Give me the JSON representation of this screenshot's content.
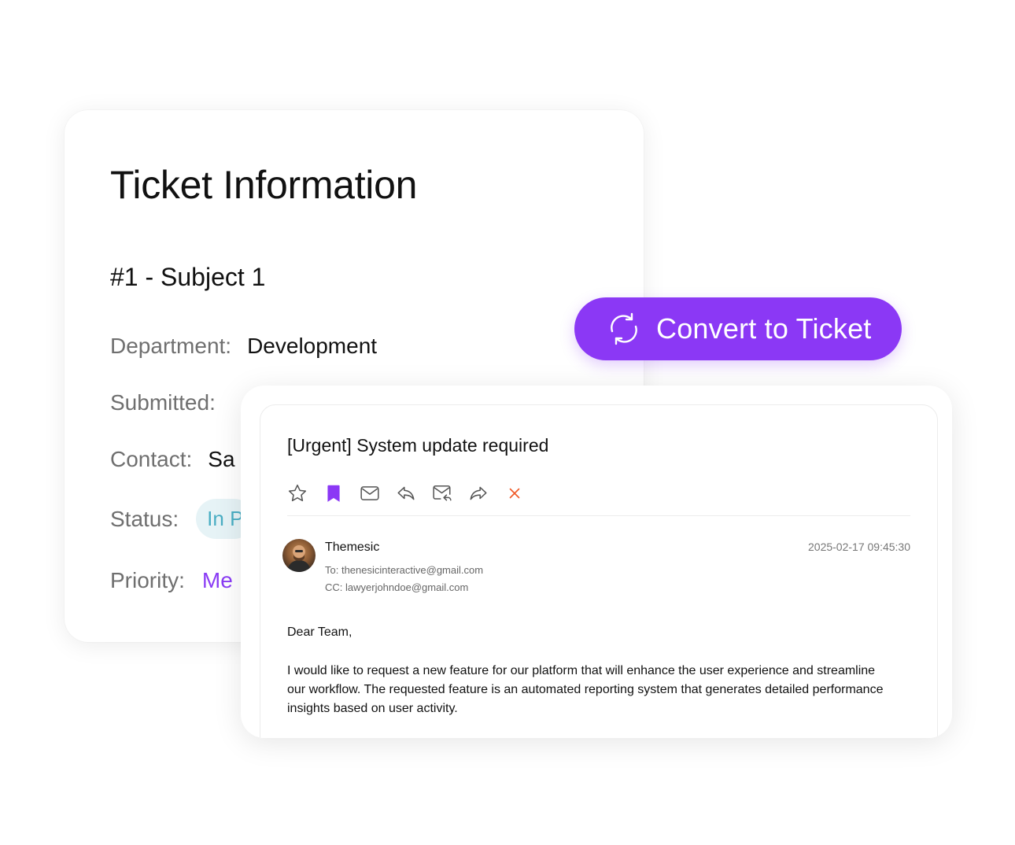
{
  "ticket": {
    "title": "Ticket Information",
    "subject": "#1 - Subject 1",
    "department_label": "Department:",
    "department_value": "Development",
    "submitted_label": "Submitted:",
    "contact_label": "Contact:",
    "contact_value": "Sa",
    "status_label": "Status:",
    "status_value": "In P",
    "priority_label": "Priority:",
    "priority_value": "Me"
  },
  "convert_button": {
    "label": "Convert to Ticket",
    "icon": "refresh-icon"
  },
  "email": {
    "subject": "[Urgent] System update required",
    "toolbar_icons": [
      "star-icon",
      "bookmark-icon",
      "mail-icon",
      "reply-icon",
      "reply-all-icon",
      "forward-icon",
      "close-icon"
    ],
    "sender": "Themesic",
    "date": "2025-02-17 09:45:30",
    "to": "To: thenesicinteractive@gmail.com",
    "cc": "CC: lawyerjohndoe@gmail.com",
    "greeting": "Dear Team,",
    "body": "I would like to request a new feature for our platform that will enhance the user experience and streamline our workflow. The requested feature is an automated reporting system that generates detailed performance insights based on user activity."
  },
  "colors": {
    "accent": "#8b38f5",
    "status_bg": "#e6f3f6",
    "status_text": "#4aaec4",
    "close_icon": "#f05a28"
  }
}
